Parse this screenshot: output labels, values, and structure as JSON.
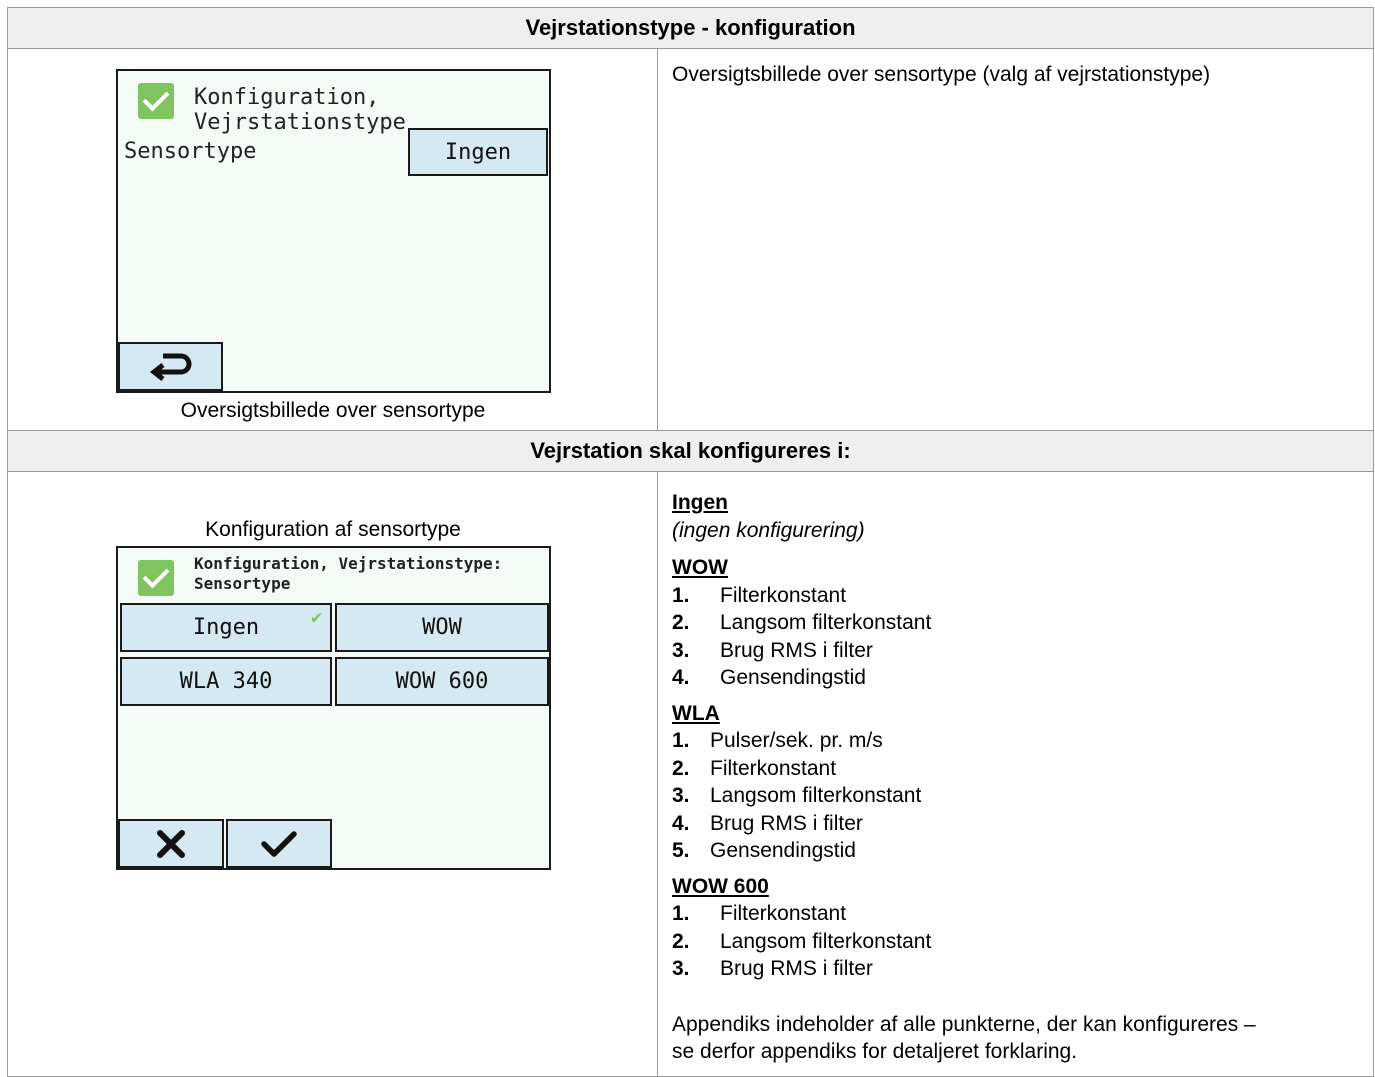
{
  "top_header": "Vejrstationstype - konfiguration",
  "screen1": {
    "title": "Konfiguration, Vejrstationstype",
    "label": "Sensortype",
    "value_button": "Ingen",
    "caption": "Oversigtsbillede over sensortype"
  },
  "top_right_text": "Oversigtsbillede over sensortype (valg af vejrstationstype)",
  "mid_header": "Vejrstation skal konfigureres i:",
  "screen2": {
    "caption": "Konfiguration af sensortype",
    "title_line1": "Konfiguration, Vejrstationstype:",
    "title_line2": "Sensortype",
    "options": [
      "Ingen",
      "WOW",
      "WLA 340",
      "WOW 600"
    ]
  },
  "sections": [
    {
      "title": "Ingen",
      "subtitle": "(ingen konfigurering)",
      "items": []
    },
    {
      "title": "WOW",
      "subtitle": "",
      "items": [
        {
          "num": "1.",
          "text": "Filterkonstant"
        },
        {
          "num": "2.",
          "text": "Langsom filterkonstant"
        },
        {
          "num": "3.",
          "text": "Brug RMS i filter"
        },
        {
          "num": "4.",
          "text": "Gensendingstid"
        }
      ]
    },
    {
      "title": "WLA",
      "subtitle": "",
      "items": [
        {
          "num": "1.",
          "text": "Pulser/sek. pr. m/s"
        },
        {
          "num": "2.",
          "text": "Filterkonstant"
        },
        {
          "num": "3.",
          "text": "Langsom filterkonstant"
        },
        {
          "num": "4.",
          "text": "Brug RMS i filter"
        },
        {
          "num": "5.",
          "text": "Gensendingstid"
        }
      ]
    },
    {
      "title": "WOW 600",
      "subtitle": "",
      "items": [
        {
          "num": "1.",
          "text": "Filterkonstant"
        },
        {
          "num": "2.",
          "text": "Langsom filterkonstant"
        },
        {
          "num": "3.",
          "text": "Brug RMS i filter"
        }
      ]
    }
  ],
  "footer_note_line1": "Appendiks indeholder af alle punkterne, der kan konfigureres –",
  "footer_note_line2": "se derfor appendiks for detaljeret forklaring.",
  "icons": [
    "checkbox-icon",
    "return-arrow-icon",
    "cancel-x-icon",
    "confirm-check-icon",
    "selected-check-icon"
  ],
  "colors": {
    "screen_bg": "#f4fbf6",
    "button_bg": "#d4e9f1",
    "check_green": "#7fc45f",
    "header_bg": "#efefef"
  }
}
